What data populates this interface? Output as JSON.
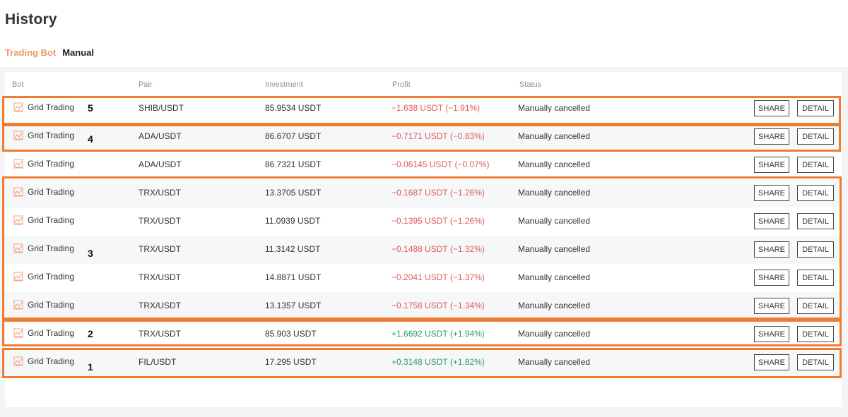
{
  "page": {
    "title": "History"
  },
  "tabs": [
    {
      "label": "Trading Bot",
      "active": true
    },
    {
      "label": "Manual",
      "active": false
    }
  ],
  "columns": {
    "bot": "Bot",
    "pair": "Pair",
    "investment": "Investment",
    "profit": "Profit",
    "status": "Status"
  },
  "rows": [
    {
      "bot": "Grid Trading",
      "pair": "SHIB/USDT",
      "investment": "85.9534 USDT",
      "profit": "−1.638 USDT (−1.91%)",
      "profit_sign": "neg",
      "status": "Manually cancelled",
      "share": "SHARE",
      "detail": "DETAIL"
    },
    {
      "bot": "Grid Trading",
      "pair": "ADA/USDT",
      "investment": "86.6707 USDT",
      "profit": "−0.7171 USDT (−0.83%)",
      "profit_sign": "neg",
      "status": "Manually cancelled",
      "share": "SHARE",
      "detail": "DETAIL"
    },
    {
      "bot": "Grid Trading",
      "pair": "ADA/USDT",
      "investment": "86.7321 USDT",
      "profit": "−0.06145 USDT (−0.07%)",
      "profit_sign": "neg",
      "status": "Manually cancelled",
      "share": "SHARE",
      "detail": "DETAIL"
    },
    {
      "bot": "Grid Trading",
      "pair": "TRX/USDT",
      "investment": "13.3705 USDT",
      "profit": "−0.1687 USDT (−1.26%)",
      "profit_sign": "neg",
      "status": "Manually cancelled",
      "share": "SHARE",
      "detail": "DETAIL"
    },
    {
      "bot": "Grid Trading",
      "pair": "TRX/USDT",
      "investment": "11.0939 USDT",
      "profit": "−0.1395 USDT (−1.26%)",
      "profit_sign": "neg",
      "status": "Manually cancelled",
      "share": "SHARE",
      "detail": "DETAIL"
    },
    {
      "bot": "Grid Trading",
      "pair": "TRX/USDT",
      "investment": "11.3142 USDT",
      "profit": "−0.1488 USDT (−1.32%)",
      "profit_sign": "neg",
      "status": "Manually cancelled",
      "share": "SHARE",
      "detail": "DETAIL"
    },
    {
      "bot": "Grid Trading",
      "pair": "TRX/USDT",
      "investment": "14.8871 USDT",
      "profit": "−0.2041 USDT (−1.37%)",
      "profit_sign": "neg",
      "status": "Manually cancelled",
      "share": "SHARE",
      "detail": "DETAIL"
    },
    {
      "bot": "Grid Trading",
      "pair": "TRX/USDT",
      "investment": "13.1357 USDT",
      "profit": "−0.1758 USDT (−1.34%)",
      "profit_sign": "neg",
      "status": "Manually cancelled",
      "share": "SHARE",
      "detail": "DETAIL"
    },
    {
      "bot": "Grid Trading",
      "pair": "TRX/USDT",
      "investment": "85.903 USDT",
      "profit": "+1.6692 USDT (+1.94%)",
      "profit_sign": "pos",
      "status": "Manually cancelled",
      "share": "SHARE",
      "detail": "DETAIL"
    },
    {
      "bot": "Grid Trading",
      "pair": "FIL/USDT",
      "investment": "17.295 USDT",
      "profit": "+0.3148 USDT (+1.82%)",
      "profit_sign": "pos",
      "status": "Manually cancelled",
      "share": "SHARE",
      "detail": "DETAIL"
    }
  ],
  "annotations": [
    {
      "label": "5"
    },
    {
      "label": "4"
    },
    {
      "label": "3"
    },
    {
      "label": "2"
    },
    {
      "label": "1"
    }
  ],
  "colors": {
    "accent": "#f0956a",
    "negative": "#e05a5a",
    "positive": "#2e9a6a",
    "highlight": "#ee7d33",
    "bot_icon": "grid-chart-icon"
  }
}
